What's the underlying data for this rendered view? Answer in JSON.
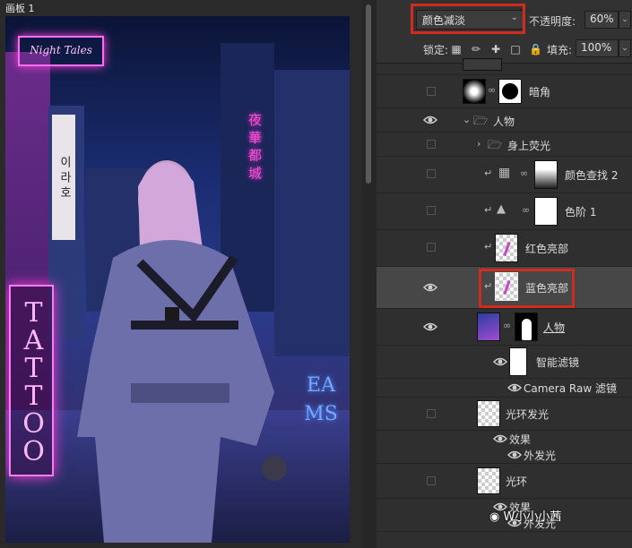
{
  "document": {
    "title": "画板 1"
  },
  "artwork": {
    "neon_sign_top": "Night Tales",
    "neon_sign_left": "TATTOO",
    "signs": [
      "이 라 호",
      "夜 華 都 城",
      "EA",
      "MS"
    ]
  },
  "panel": {
    "blend_mode": "颜色减淡",
    "opacity_label": "不透明度:",
    "opacity_value": "60%",
    "lock_label": "锁定:",
    "fill_label": "填充:",
    "fill_value": "100%"
  },
  "layers": [
    {
      "name": "暗角"
    },
    {
      "name": "人物"
    },
    {
      "name": "身上荧光"
    },
    {
      "name": "颜色查找 2"
    },
    {
      "name": "色阶 1"
    },
    {
      "name": "红色亮部"
    },
    {
      "name": "蓝色亮部"
    },
    {
      "name": "人物"
    },
    {
      "name": "智能滤镜"
    },
    {
      "name": "Camera Raw 滤镜"
    },
    {
      "name": "光环发光"
    },
    {
      "name": "效果"
    },
    {
      "name": "外发光"
    },
    {
      "name": "光环"
    },
    {
      "name": "效果"
    },
    {
      "name": "外发光"
    }
  ],
  "watermark": "W小小小茜",
  "colors": {
    "highlight": "#d02b1e",
    "neon_pink": "#ff3fd8",
    "panel_bg": "#2f2f2f"
  }
}
